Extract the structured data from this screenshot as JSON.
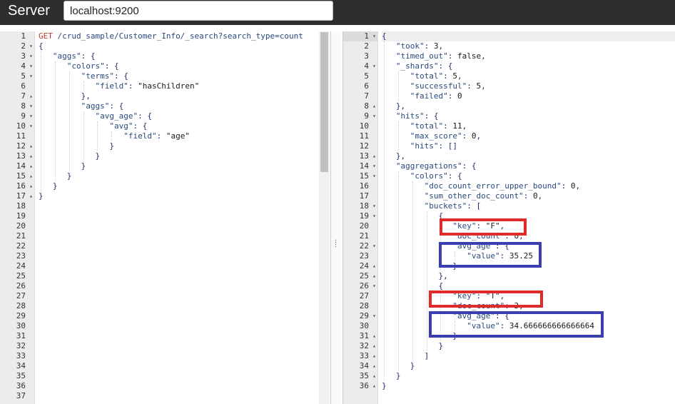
{
  "header": {
    "title": "Server",
    "server_url": "localhost:9200"
  },
  "left_editor": {
    "total_lines": 37,
    "lines": [
      {
        "t": [
          [
            "method",
            "GET"
          ],
          [
            "plain",
            " "
          ],
          [
            "path",
            "/crud_sample/Customer_Info/_search?search_type=count"
          ]
        ],
        "fold": ""
      },
      {
        "t": [
          [
            "plain",
            "{"
          ]
        ],
        "fold": "▾"
      },
      {
        "t": [
          [
            "plain",
            "   "
          ],
          [
            "key",
            "\"aggs\""
          ],
          [
            "plain",
            ": {"
          ]
        ],
        "fold": "▾"
      },
      {
        "t": [
          [
            "plain",
            "      "
          ],
          [
            "key",
            "\"colors\""
          ],
          [
            "plain",
            ": {"
          ]
        ],
        "fold": "▾"
      },
      {
        "t": [
          [
            "plain",
            "         "
          ],
          [
            "key",
            "\"terms\""
          ],
          [
            "plain",
            ": {"
          ]
        ],
        "fold": "▾"
      },
      {
        "t": [
          [
            "plain",
            "            "
          ],
          [
            "key",
            "\"field\""
          ],
          [
            "plain",
            ": "
          ],
          [
            "str",
            "\"hasChildren\""
          ]
        ],
        "fold": ""
      },
      {
        "t": [
          [
            "plain",
            "         },"
          ]
        ],
        "fold": "▴"
      },
      {
        "t": [
          [
            "plain",
            "         "
          ],
          [
            "key",
            "\"aggs\""
          ],
          [
            "plain",
            ": {"
          ]
        ],
        "fold": "▾"
      },
      {
        "t": [
          [
            "plain",
            "            "
          ],
          [
            "key",
            "\"avg_age\""
          ],
          [
            "plain",
            ": {"
          ]
        ],
        "fold": "▾"
      },
      {
        "t": [
          [
            "plain",
            "               "
          ],
          [
            "key",
            "\"avg\""
          ],
          [
            "plain",
            ": {"
          ]
        ],
        "fold": "▾"
      },
      {
        "t": [
          [
            "plain",
            "                  "
          ],
          [
            "key",
            "\"field\""
          ],
          [
            "plain",
            ": "
          ],
          [
            "str",
            "\"age\""
          ]
        ],
        "fold": ""
      },
      {
        "t": [
          [
            "plain",
            "               }"
          ]
        ],
        "fold": "▴"
      },
      {
        "t": [
          [
            "plain",
            "            }"
          ]
        ],
        "fold": "▴"
      },
      {
        "t": [
          [
            "plain",
            "         }"
          ]
        ],
        "fold": "▴"
      },
      {
        "t": [
          [
            "plain",
            "      }"
          ]
        ],
        "fold": "▴"
      },
      {
        "t": [
          [
            "plain",
            "   }"
          ]
        ],
        "fold": "▴"
      },
      {
        "t": [
          [
            "plain",
            "}"
          ]
        ],
        "fold": "▴"
      }
    ]
  },
  "right_editor": {
    "total_lines": 36,
    "lines": [
      {
        "t": [
          [
            "plain",
            "{"
          ]
        ],
        "fold": "▾"
      },
      {
        "t": [
          [
            "plain",
            "   "
          ],
          [
            "key",
            "\"took\""
          ],
          [
            "plain",
            ": "
          ],
          [
            "num",
            "3"
          ],
          [
            "plain",
            ","
          ]
        ],
        "fold": ""
      },
      {
        "t": [
          [
            "plain",
            "   "
          ],
          [
            "key",
            "\"timed_out\""
          ],
          [
            "plain",
            ": "
          ],
          [
            "num",
            "false"
          ],
          [
            "plain",
            ","
          ]
        ],
        "fold": ""
      },
      {
        "t": [
          [
            "plain",
            "   "
          ],
          [
            "key",
            "\"_shards\""
          ],
          [
            "plain",
            ": {"
          ]
        ],
        "fold": "▾"
      },
      {
        "t": [
          [
            "plain",
            "      "
          ],
          [
            "key",
            "\"total\""
          ],
          [
            "plain",
            ": "
          ],
          [
            "num",
            "5"
          ],
          [
            "plain",
            ","
          ]
        ],
        "fold": ""
      },
      {
        "t": [
          [
            "plain",
            "      "
          ],
          [
            "key",
            "\"successful\""
          ],
          [
            "plain",
            ": "
          ],
          [
            "num",
            "5"
          ],
          [
            "plain",
            ","
          ]
        ],
        "fold": ""
      },
      {
        "t": [
          [
            "plain",
            "      "
          ],
          [
            "key",
            "\"failed\""
          ],
          [
            "plain",
            ": "
          ],
          [
            "num",
            "0"
          ]
        ],
        "fold": ""
      },
      {
        "t": [
          [
            "plain",
            "   },"
          ]
        ],
        "fold": "▴"
      },
      {
        "t": [
          [
            "plain",
            "   "
          ],
          [
            "key",
            "\"hits\""
          ],
          [
            "plain",
            ": {"
          ]
        ],
        "fold": "▾"
      },
      {
        "t": [
          [
            "plain",
            "      "
          ],
          [
            "key",
            "\"total\""
          ],
          [
            "plain",
            ": "
          ],
          [
            "num",
            "11"
          ],
          [
            "plain",
            ","
          ]
        ],
        "fold": ""
      },
      {
        "t": [
          [
            "plain",
            "      "
          ],
          [
            "key",
            "\"max_score\""
          ],
          [
            "plain",
            ": "
          ],
          [
            "num",
            "0"
          ],
          [
            "plain",
            ","
          ]
        ],
        "fold": ""
      },
      {
        "t": [
          [
            "plain",
            "      "
          ],
          [
            "key",
            "\"hits\""
          ],
          [
            "plain",
            ": []"
          ]
        ],
        "fold": ""
      },
      {
        "t": [
          [
            "plain",
            "   },"
          ]
        ],
        "fold": "▴"
      },
      {
        "t": [
          [
            "plain",
            "   "
          ],
          [
            "key",
            "\"aggregations\""
          ],
          [
            "plain",
            ": {"
          ]
        ],
        "fold": "▾"
      },
      {
        "t": [
          [
            "plain",
            "      "
          ],
          [
            "key",
            "\"colors\""
          ],
          [
            "plain",
            ": {"
          ]
        ],
        "fold": "▾"
      },
      {
        "t": [
          [
            "plain",
            "         "
          ],
          [
            "key",
            "\"doc_count_error_upper_bound\""
          ],
          [
            "plain",
            ": "
          ],
          [
            "num",
            "0"
          ],
          [
            "plain",
            ","
          ]
        ],
        "fold": ""
      },
      {
        "t": [
          [
            "plain",
            "         "
          ],
          [
            "key",
            "\"sum_other_doc_count\""
          ],
          [
            "plain",
            ": "
          ],
          [
            "num",
            "0"
          ],
          [
            "plain",
            ","
          ]
        ],
        "fold": ""
      },
      {
        "t": [
          [
            "plain",
            "         "
          ],
          [
            "key",
            "\"buckets\""
          ],
          [
            "plain",
            ": ["
          ]
        ],
        "fold": "▾"
      },
      {
        "t": [
          [
            "plain",
            "            {"
          ]
        ],
        "fold": "▾"
      },
      {
        "t": [
          [
            "plain",
            "               "
          ],
          [
            "key",
            "\"key\""
          ],
          [
            "plain",
            ": "
          ],
          [
            "str",
            "\"F\""
          ],
          [
            "plain",
            ","
          ]
        ],
        "fold": ""
      },
      {
        "t": [
          [
            "plain",
            "               "
          ],
          [
            "key",
            "\"doc_count\""
          ],
          [
            "plain",
            ": "
          ],
          [
            "num",
            "8"
          ],
          [
            "plain",
            ","
          ]
        ],
        "fold": ""
      },
      {
        "t": [
          [
            "plain",
            "               "
          ],
          [
            "key",
            "\"avg_age\""
          ],
          [
            "plain",
            ": {"
          ]
        ],
        "fold": "▾"
      },
      {
        "t": [
          [
            "plain",
            "                  "
          ],
          [
            "key",
            "\"value\""
          ],
          [
            "plain",
            ": "
          ],
          [
            "num",
            "35.25"
          ]
        ],
        "fold": ""
      },
      {
        "t": [
          [
            "plain",
            "               }"
          ]
        ],
        "fold": "▴"
      },
      {
        "t": [
          [
            "plain",
            "            },"
          ]
        ],
        "fold": "▴"
      },
      {
        "t": [
          [
            "plain",
            "            {"
          ]
        ],
        "fold": "▾"
      },
      {
        "t": [
          [
            "plain",
            "               "
          ],
          [
            "key",
            "\"key\""
          ],
          [
            "plain",
            ": "
          ],
          [
            "str",
            "\"T\""
          ],
          [
            "plain",
            ","
          ]
        ],
        "fold": ""
      },
      {
        "t": [
          [
            "plain",
            "               "
          ],
          [
            "key",
            "\"doc_count\""
          ],
          [
            "plain",
            ": "
          ],
          [
            "num",
            "3"
          ],
          [
            "plain",
            ","
          ]
        ],
        "fold": ""
      },
      {
        "t": [
          [
            "plain",
            "               "
          ],
          [
            "key",
            "\"avg_age\""
          ],
          [
            "plain",
            ": {"
          ]
        ],
        "fold": "▾"
      },
      {
        "t": [
          [
            "plain",
            "                  "
          ],
          [
            "key",
            "\"value\""
          ],
          [
            "plain",
            ": "
          ],
          [
            "num",
            "34.666666666666664"
          ]
        ],
        "fold": ""
      },
      {
        "t": [
          [
            "plain",
            "               }"
          ]
        ],
        "fold": "▴"
      },
      {
        "t": [
          [
            "plain",
            "            }"
          ]
        ],
        "fold": "▴"
      },
      {
        "t": [
          [
            "plain",
            "         ]"
          ]
        ],
        "fold": "▴"
      },
      {
        "t": [
          [
            "plain",
            "      }"
          ]
        ],
        "fold": "▴"
      },
      {
        "t": [
          [
            "plain",
            "   }"
          ]
        ],
        "fold": "▴"
      },
      {
        "t": [
          [
            "plain",
            "}"
          ]
        ],
        "fold": "▴"
      }
    ]
  },
  "colors": {
    "highlight_key": "#e02b2b",
    "highlight_value": "#3a3fb0"
  }
}
